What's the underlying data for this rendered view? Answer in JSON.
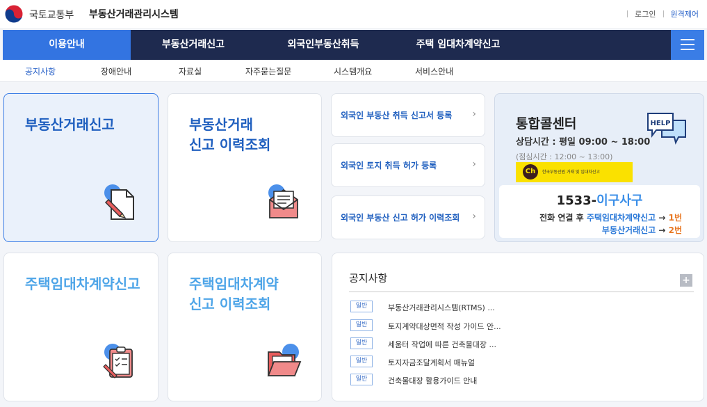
{
  "header": {
    "ministry": "국토교통부",
    "system_name": "부동산거래관리시스템",
    "login": "로그인",
    "remote_support": "원격제어"
  },
  "nav": {
    "items": [
      {
        "label": "이용안내"
      },
      {
        "label": "부동산거래신고"
      },
      {
        "label": "외국인부동산취득"
      },
      {
        "label": "주택 임대차계약신고"
      }
    ]
  },
  "subnav": {
    "items": [
      {
        "label": "공지사항"
      },
      {
        "label": "장애안내"
      },
      {
        "label": "자료실"
      },
      {
        "label": "자주묻는질문"
      },
      {
        "label": "시스템개요"
      },
      {
        "label": "서비스안내"
      }
    ]
  },
  "cards": {
    "report": "부동산거래신고",
    "report_history": "부동산거래\n신고 이력조회",
    "lease": "주택임대차계약신고",
    "lease_history": "주택임대차계약\n신고 이력조회"
  },
  "links": [
    {
      "label": "외국인 부동산 취득 신고서 등록"
    },
    {
      "label": "외국인 토지 취득 허가 등록"
    },
    {
      "label": "외국인 부동산 신고 허가 이력조회"
    }
  ],
  "callcenter": {
    "title": "통합콜센터",
    "hours": "상담시간 : 평일 09:00 ~ 18:00",
    "lunch": "(점심시간 : 12:00 ~ 13:00)",
    "help_label": "HELP",
    "kakao_ch": "Ch",
    "kakao_text": "한국부동산원 거래 및 임대차신고",
    "number_prefix": "1533-",
    "number_korean": "이구사구",
    "line1_prefix": "전화 연결 후 ",
    "line1_target": "주택임대차계약신고",
    "line1_arrow": " → ",
    "line1_num": "1번",
    "line2_target": "부동산거래신고",
    "line2_arrow": " → ",
    "line2_num": "2번"
  },
  "notice": {
    "title": "공지사항",
    "plus": "+",
    "items": [
      {
        "badge": "일반",
        "text": "부동산거래관리시스템(RTMS) ..."
      },
      {
        "badge": "일반",
        "text": "토지계약대상면적 작성 가이드 안..."
      },
      {
        "badge": "일반",
        "text": "세움터 작업에 따른 건축물대장 ..."
      },
      {
        "badge": "일반",
        "text": "토지자금조달계획서 매뉴얼"
      },
      {
        "badge": "일반",
        "text": "건축물대장 활용가이드 안내"
      }
    ]
  },
  "colors": {
    "nav_bg": "#1e2a4f",
    "nav_active": "#3374e1",
    "title_dark_blue": "#1f5fbf",
    "title_light_blue": "#4ea5e8",
    "accent_orange": "#e87722",
    "kakao_yellow": "#fae100"
  }
}
